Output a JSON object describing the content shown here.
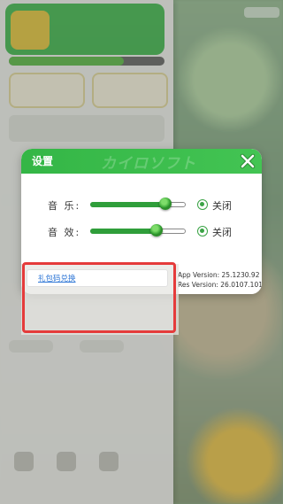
{
  "settings_dialog": {
    "title": "设置",
    "header_decor_text": "カイロソフト",
    "close_icon": "close-x-icon",
    "music": {
      "label": "音 乐:",
      "volume_fraction": 0.79,
      "toggle_label": "关闭"
    },
    "sound": {
      "label": "音 效:",
      "volume_fraction": 0.69,
      "toggle_label": "关闭"
    },
    "app_version": "App Version: 25.1230.92",
    "res_version": "Res Version: 26.0107.101",
    "gift_code_link": "礼包码兑换"
  },
  "colors": {
    "accent_green": "#3fb84c",
    "link_blue": "#2f77d6",
    "highlight_red": "#e53b3b"
  }
}
